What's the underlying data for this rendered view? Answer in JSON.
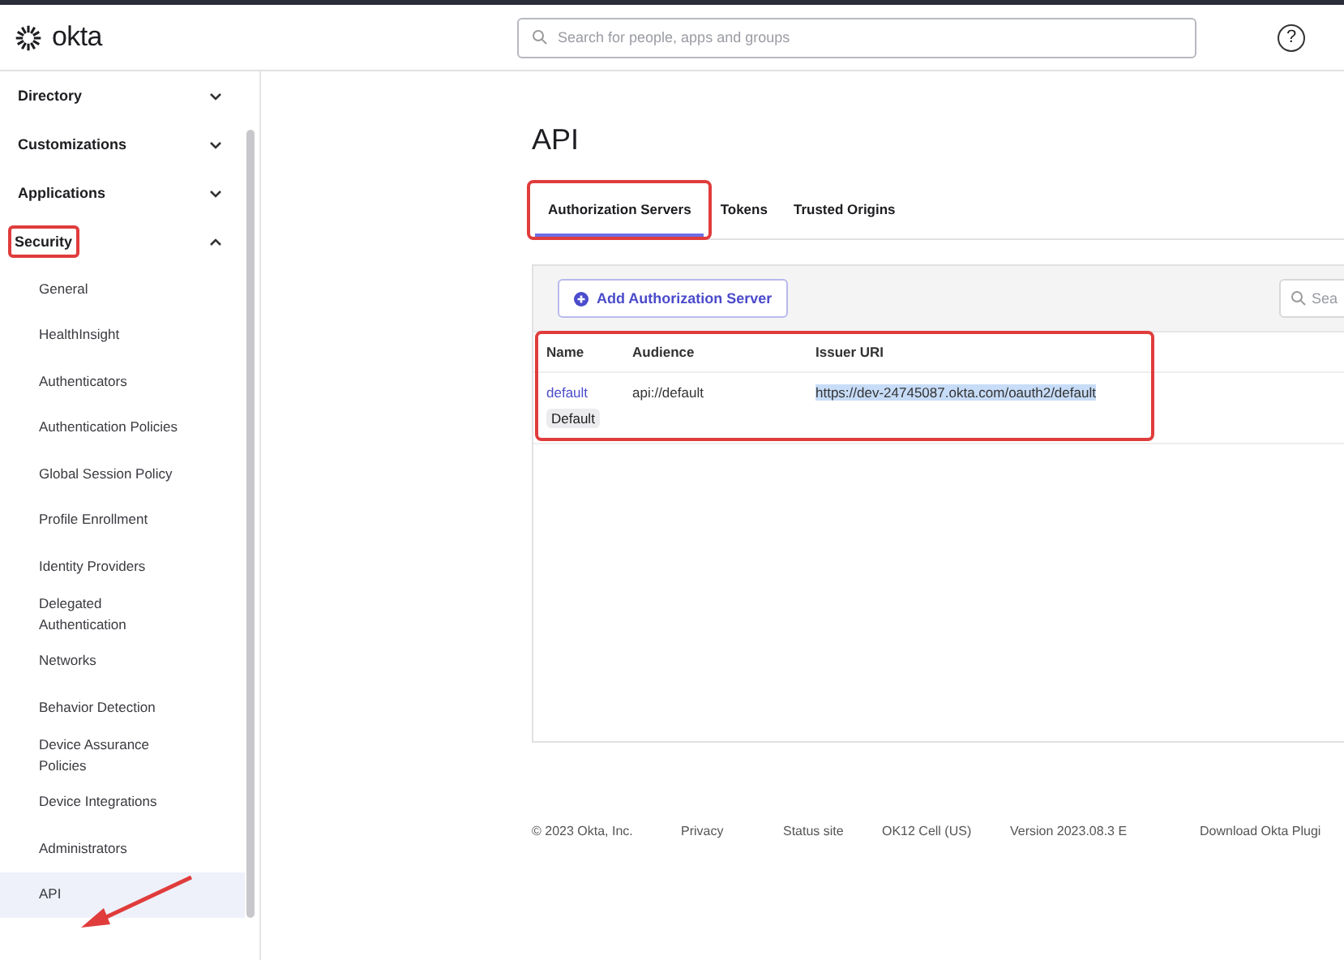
{
  "header": {
    "logo": "okta",
    "search": {
      "placeholder": "Search for people, apps and groups"
    },
    "help": "?"
  },
  "sidebar": {
    "items": [
      {
        "label": "Directory",
        "expanded": false,
        "highlighted": false
      },
      {
        "label": "Customizations",
        "expanded": false,
        "highlighted": false
      },
      {
        "label": "Applications",
        "expanded": false,
        "highlighted": false
      },
      {
        "label": "Security",
        "expanded": true,
        "highlighted": true,
        "children": [
          {
            "label": "General",
            "selected": false
          },
          {
            "label": "HealthInsight",
            "selected": false
          },
          {
            "label": "Authenticators",
            "selected": false
          },
          {
            "label": "Authentication Policies",
            "selected": false
          },
          {
            "label": "Global Session Policy",
            "selected": false
          },
          {
            "label": "Profile Enrollment",
            "selected": false
          },
          {
            "label": "Identity Providers",
            "selected": false
          },
          {
            "label": "Delegated Authentication",
            "selected": false
          },
          {
            "label": "Networks",
            "selected": false
          },
          {
            "label": "Behavior Detection",
            "selected": false
          },
          {
            "label": "Device Assurance Policies",
            "selected": false
          },
          {
            "label": "Device Integrations",
            "selected": false
          },
          {
            "label": "Administrators",
            "selected": false
          },
          {
            "label": "API",
            "selected": true
          }
        ]
      }
    ]
  },
  "page": {
    "title": "API",
    "tabs": [
      {
        "label": "Authorization Servers",
        "selected": true,
        "highlighted": true
      },
      {
        "label": "Tokens",
        "selected": false,
        "highlighted": false
      },
      {
        "label": "Trusted Origins",
        "selected": false,
        "highlighted": false
      }
    ],
    "add_button": "Add Authorization Server",
    "search": {
      "placeholder": "Sea"
    },
    "table": {
      "highlighted": true,
      "columns": [
        "Name",
        "Audience",
        "Issuer URI"
      ],
      "rows": [
        {
          "name": "default",
          "badge": "Default",
          "audience": "api://default",
          "issuer_uri": "https://dev-24745087.okta.com/oauth2/default",
          "uri_text_selected": true
        }
      ]
    }
  },
  "footer": [
    "© 2023 Okta, Inc.",
    "Privacy",
    "Status site",
    "OK12 Cell (US)",
    "Version 2023.08.3 E",
    "Download Okta Plugi"
  ]
}
